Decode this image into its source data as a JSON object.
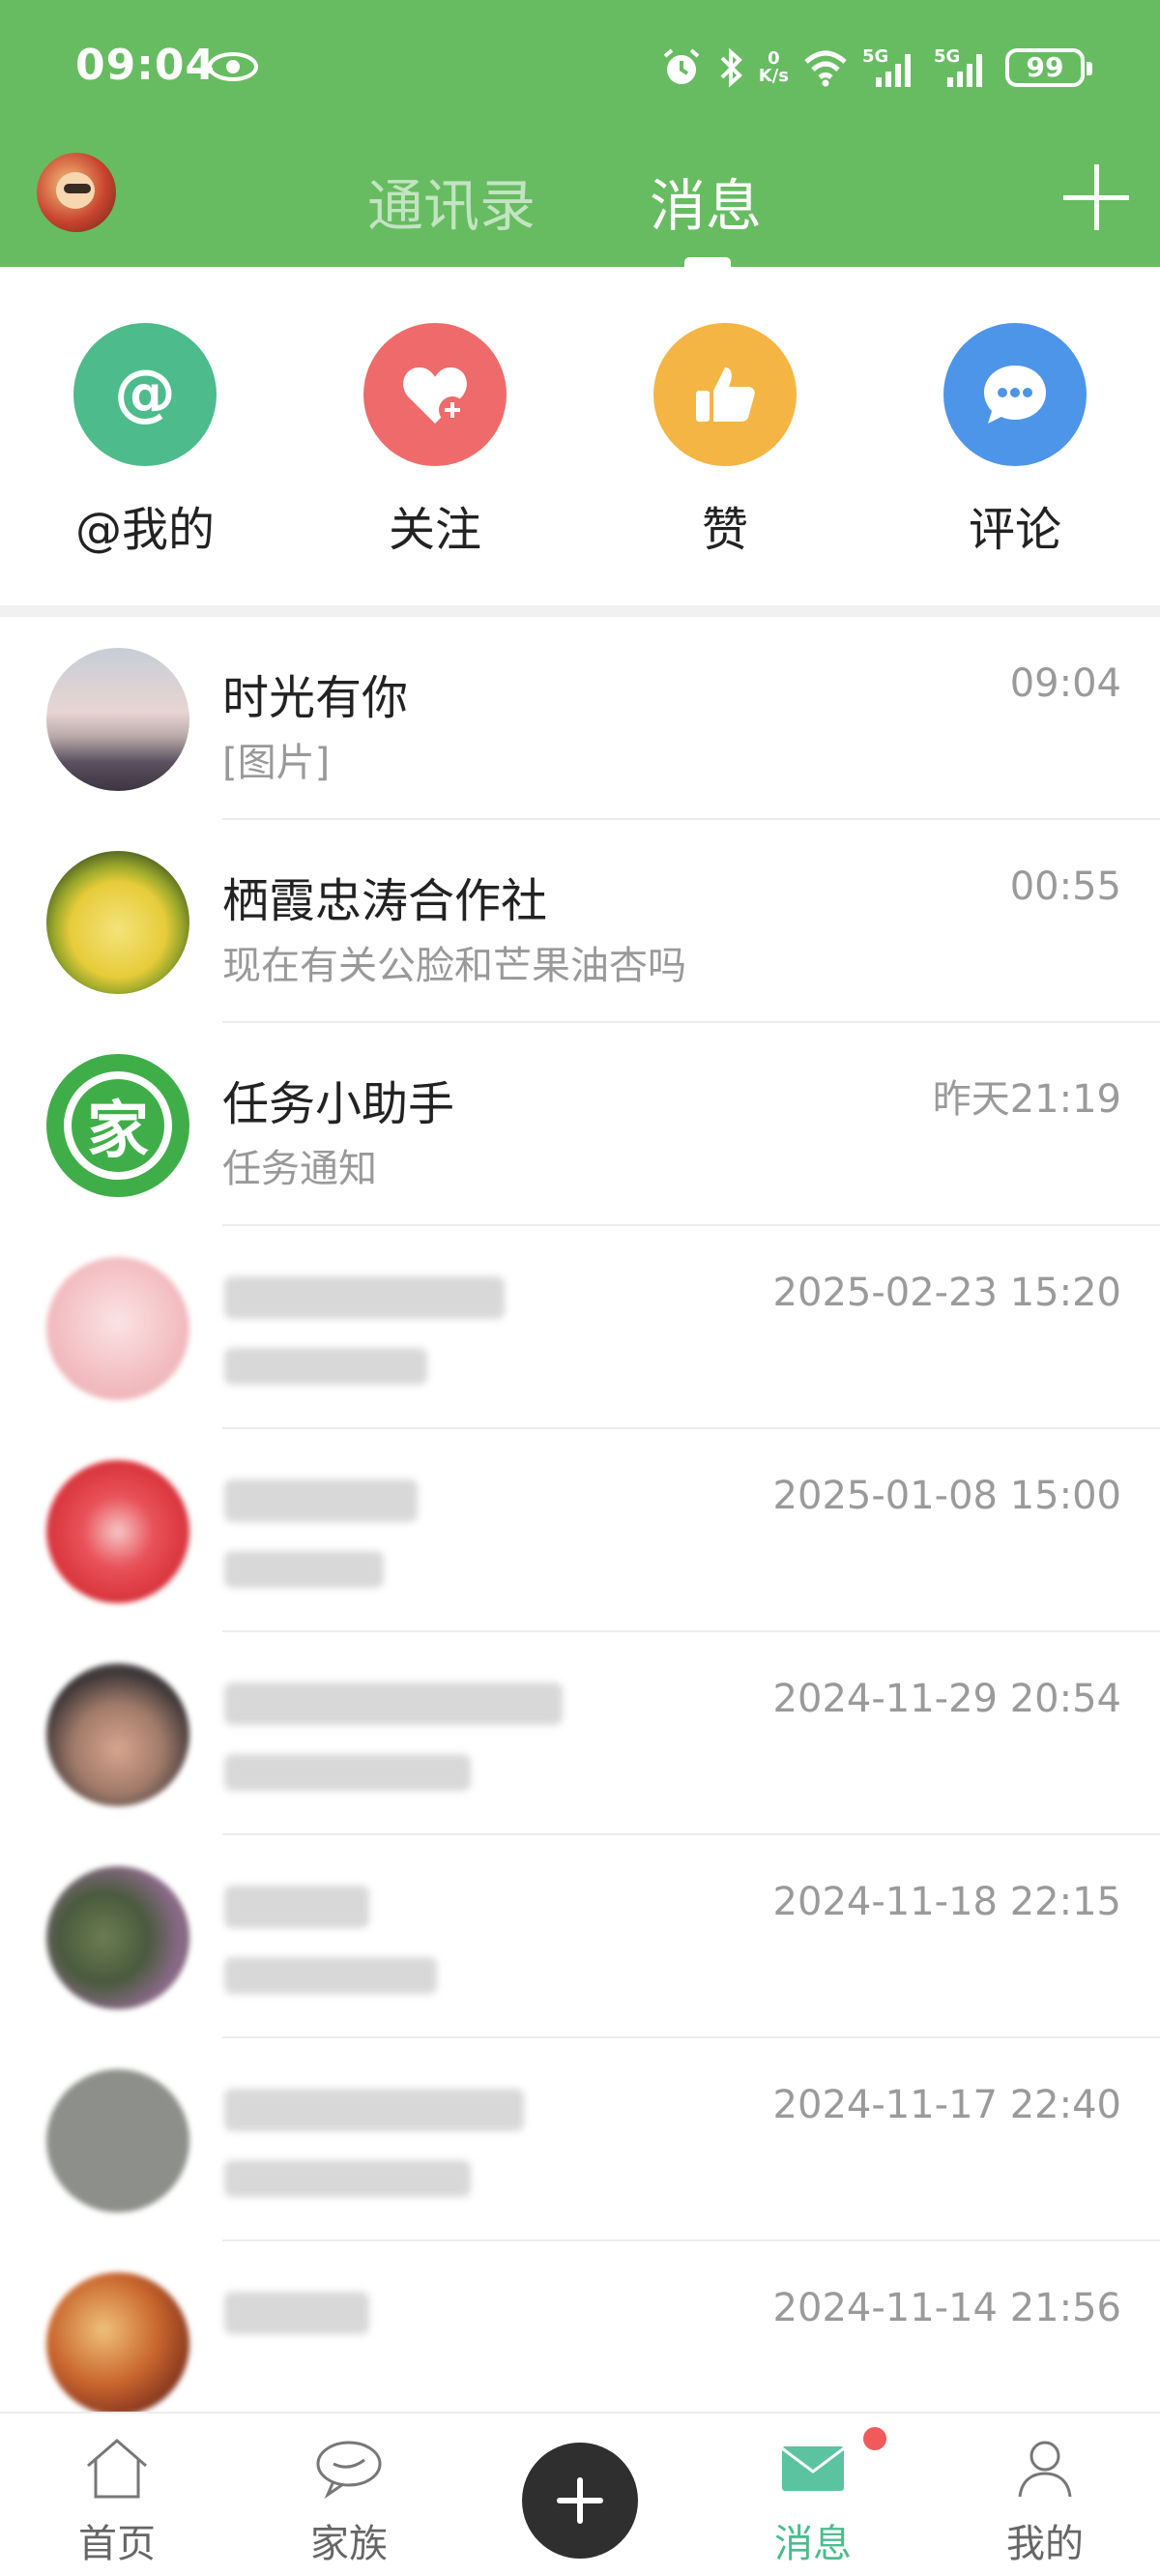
{
  "status_bar": {
    "time": "09:04",
    "net_speed_value": "0",
    "net_speed_unit": "K/s",
    "sig1": "5G",
    "sig2": "5G",
    "battery": "99"
  },
  "header": {
    "tabs": [
      {
        "label": "通讯录",
        "active": false
      },
      {
        "label": "消息",
        "active": true
      }
    ],
    "colors": {
      "bar": "#67bc62"
    }
  },
  "quick_actions": [
    {
      "label": "@我的",
      "icon": "at-icon",
      "color": "#4dbb8c"
    },
    {
      "label": "关注",
      "icon": "heart-plus-icon",
      "color": "#ef6b6b"
    },
    {
      "label": "赞",
      "icon": "thumbs-up-icon",
      "color": "#f5b544"
    },
    {
      "label": "评论",
      "icon": "chat-bubble-icon",
      "color": "#4d95e8"
    }
  ],
  "conversations": [
    {
      "name": "时光有你",
      "preview": "[图片]",
      "time": "09:04"
    },
    {
      "name": "栖霞忠涛合作社",
      "preview": "现在有关公脸和芒果油杏吗",
      "time": "00:55"
    },
    {
      "name": "任务小助手",
      "preview": "任务通知",
      "time": "昨天21:19",
      "avatar_text": "家"
    },
    {
      "name": "",
      "preview": "",
      "time": "2025-02-23 15:20"
    },
    {
      "name": "",
      "preview": "",
      "time": "2025-01-08 15:00"
    },
    {
      "name": "",
      "preview": "",
      "time": "2024-11-29 20:54"
    },
    {
      "name": "",
      "preview": "",
      "time": "2024-11-18 22:15"
    },
    {
      "name": "",
      "preview": "",
      "time": "2024-11-17 22:40"
    },
    {
      "name": "",
      "preview": "",
      "time": "2024-11-14 21:56"
    }
  ],
  "bottom_nav": [
    {
      "label": "首页",
      "icon": "home-icon"
    },
    {
      "label": "家族",
      "icon": "chat-cloud-icon"
    },
    {
      "label": "",
      "icon": "plus-icon"
    },
    {
      "label": "消息",
      "icon": "mail-icon",
      "active": true,
      "accent": "#4cbc8d"
    },
    {
      "label": "我的",
      "icon": "person-icon"
    }
  ]
}
